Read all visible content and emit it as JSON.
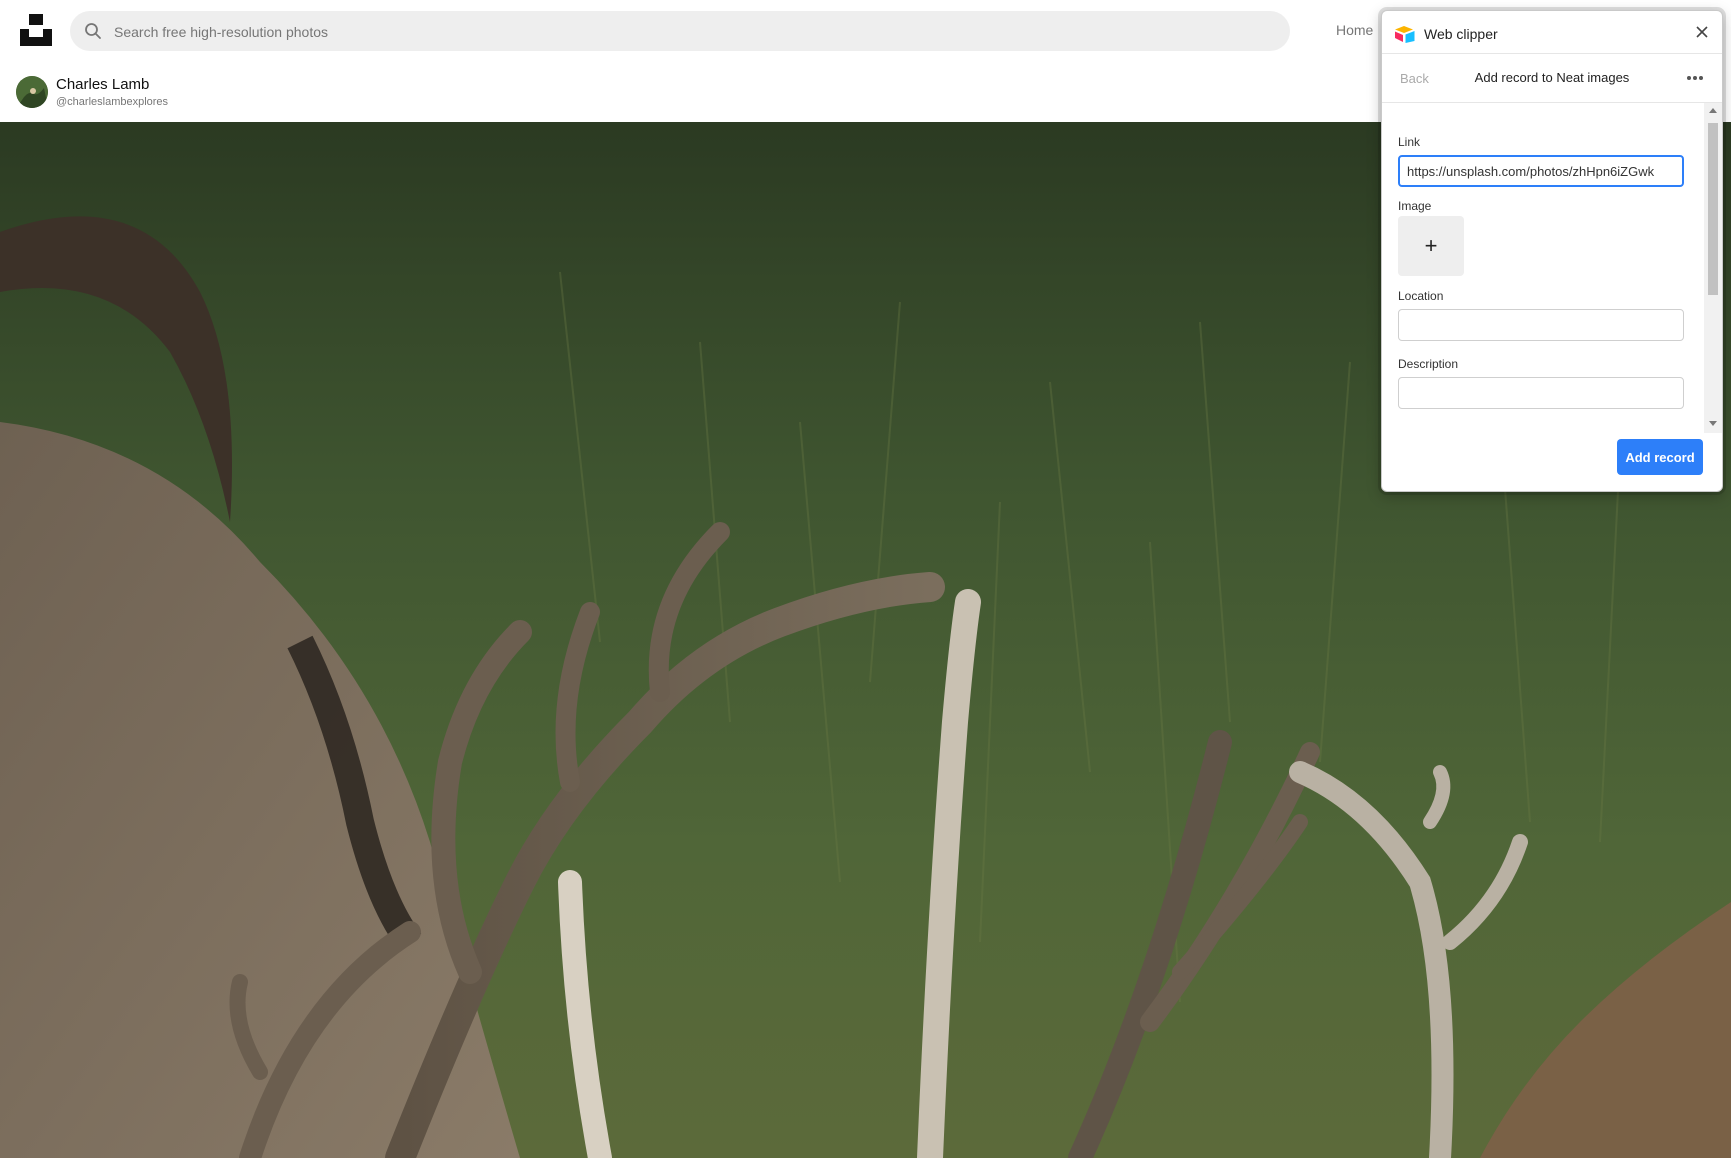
{
  "header": {
    "search_placeholder": "Search free high-resolution photos",
    "nav_home": "Home"
  },
  "author": {
    "name": "Charles Lamb",
    "handle": "@charleslambexplores"
  },
  "photo": {
    "subject": "elk-antlers-grass"
  },
  "clipper": {
    "title": "Web clipper",
    "back_label": "Back",
    "subtitle": "Add record to Neat images",
    "fields": {
      "link_label": "Link",
      "link_value": "https://unsplash.com/photos/zhHpn6iZGwk",
      "image_label": "Image",
      "image_add": "+",
      "location_label": "Location",
      "location_value": "",
      "description_label": "Description",
      "description_value": ""
    },
    "submit_label": "Add record"
  },
  "colors": {
    "accent": "#2d7ff9",
    "search_bg": "#eeeeee"
  }
}
